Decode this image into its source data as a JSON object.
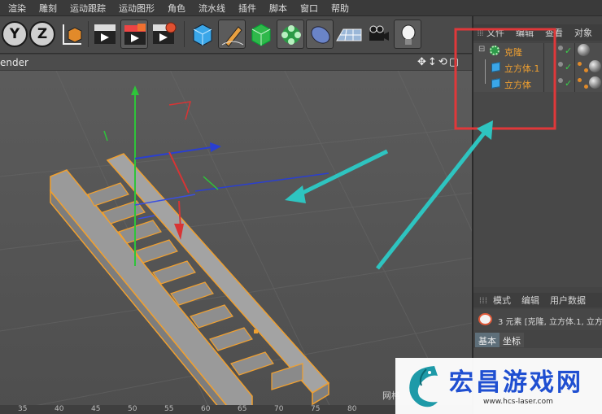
{
  "menu": {
    "items": [
      "渲染",
      "雕刻",
      "运动跟踪",
      "运动图形",
      "角色",
      "流水线",
      "插件",
      "脚本",
      "窗口",
      "帮助"
    ]
  },
  "toolbar": {
    "axis_y": "Y",
    "axis_z": "Z",
    "icons": [
      "coordinate-icon",
      "render-view-icon",
      "render-picture-viewer-icon",
      "render-settings-icon",
      "cube-icon",
      "pen-icon",
      "subdivision-icon",
      "cloner-icon",
      "deformer-icon",
      "floor-icon",
      "camera-icon",
      "light-icon"
    ]
  },
  "viewport": {
    "title": "ender",
    "nav_icons": "✥↕⟲▢",
    "grid_label": "网格",
    "ruler": [
      "35",
      "40",
      "45",
      "50",
      "55",
      "60",
      "65",
      "70",
      "75",
      "80"
    ]
  },
  "object_manager": {
    "header": [
      "文件",
      "编辑",
      "查看",
      "对象"
    ],
    "objects": [
      {
        "name": "克隆",
        "type": "cloner"
      },
      {
        "name": "立方体.1",
        "type": "cube"
      },
      {
        "name": "立方体",
        "type": "cube"
      }
    ]
  },
  "attribute_manager": {
    "header": [
      "模式",
      "编辑",
      "用户数据"
    ],
    "info": "3 元素 [克隆, 立方体.1, 立方",
    "tabs": [
      "基本",
      "坐标"
    ]
  },
  "watermark": {
    "title": "宏昌游戏网",
    "url": "www.hcs-laser.com"
  },
  "colors": {
    "selection_orange": "#f0a030",
    "annotation_red": "#e0383a",
    "annotation_cyan": "#2ec4c0",
    "watermark_blue": "#1f4fd1"
  }
}
